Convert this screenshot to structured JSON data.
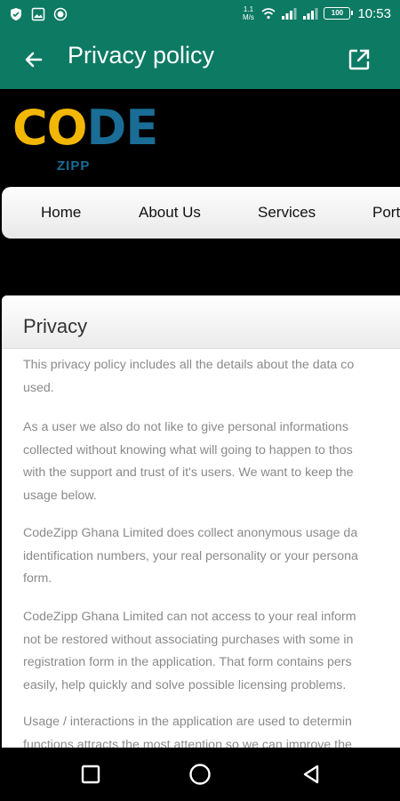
{
  "status_bar": {
    "net_speed_value": "1.1",
    "net_speed_unit": "M/s",
    "battery": "100",
    "time": "10:53"
  },
  "app_bar": {
    "title": "Privacy policy"
  },
  "site": {
    "logo_word_1": "CO",
    "logo_word_2": "DE",
    "logo_sub": "ZIPP",
    "nav": [
      "Home",
      "About Us",
      "Services",
      "Port"
    ]
  },
  "privacy": {
    "heading": "Privacy",
    "paragraphs": [
      [
        "This privacy policy includes all the details about the data co",
        "used."
      ],
      [
        "As a user we also do not like to give personal informations",
        "collected without knowing what will going to happen to thos",
        "with the support and trust of it's users. We want to keep the",
        "usage below."
      ],
      [
        "CodeZipp Ghana Limited does collect anonymous usage da",
        "identification numbers, your real personality or your persona",
        "form."
      ],
      [
        "CodeZipp Ghana Limited can not access to your real inform",
        "not be restored without associating purchases with some in",
        "registration form in the application. That form contains pers",
        "easily, help quickly and solve possible licensing problems."
      ],
      [
        "Usage / interactions in the application are used to determin",
        "functions attracts the most attention so we can improve the"
      ]
    ]
  },
  "colors": {
    "toolbar": "#0d7a63",
    "logo_yellow": "#f2b705",
    "logo_blue": "#1a6d96"
  },
  "icons": {
    "back": "arrow-left-icon",
    "open_external": "open-in-new-icon",
    "nav_recents": "square-icon",
    "nav_home": "circle-icon",
    "nav_back": "triangle-icon"
  }
}
